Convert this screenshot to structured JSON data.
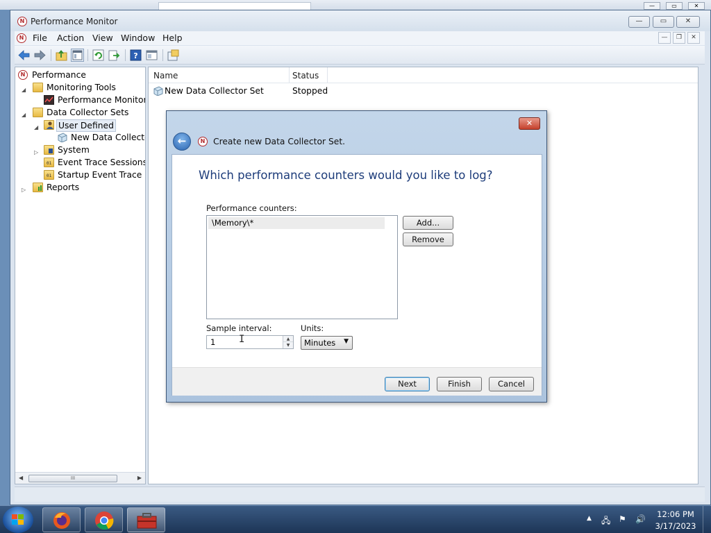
{
  "window": {
    "title": "Performance Monitor",
    "controls": {
      "minimize": "—",
      "maximize": "▭",
      "close": "✕"
    }
  },
  "menubar": {
    "items": [
      "File",
      "Action",
      "View",
      "Window",
      "Help"
    ],
    "mdi_controls": {
      "minimize": "—",
      "restore": "❐",
      "close": "✕"
    }
  },
  "toolbar": {
    "buttons": [
      "back-icon",
      "forward-icon",
      "up-folder-icon",
      "show-tree-icon",
      "refresh-icon",
      "export-icon",
      "help-icon",
      "properties-icon",
      "new-window-icon"
    ]
  },
  "tree": {
    "items": [
      {
        "label": "Performance",
        "icon": "performance-icon"
      },
      {
        "label": "Monitoring Tools",
        "icon": "folder-icon",
        "expanded": true
      },
      {
        "label": "Performance Monitor",
        "icon": "chart-icon"
      },
      {
        "label": "Data Collector Sets",
        "icon": "folder-icon",
        "expanded": true
      },
      {
        "label": "User Defined",
        "icon": "user-folder-icon",
        "expanded": true,
        "selected": true
      },
      {
        "label": "New Data Collector",
        "icon": "data-collector-icon"
      },
      {
        "label": "System",
        "icon": "system-folder-icon",
        "expanded": false
      },
      {
        "label": "Event Trace Sessions",
        "icon": "trace-folder-icon"
      },
      {
        "label": "Startup Event Trace Ses",
        "icon": "trace-folder-icon"
      },
      {
        "label": "Reports",
        "icon": "reports-folder-icon",
        "expanded": false
      }
    ],
    "scrollbar_grip": "III"
  },
  "list": {
    "columns": [
      "Name",
      "Status"
    ],
    "rows": [
      {
        "name": "New Data Collector Set",
        "status": "Stopped",
        "icon": "data-collector-icon"
      }
    ]
  },
  "dialog": {
    "title": "Create new Data Collector Set.",
    "close_label": "✕",
    "heading": "Which performance counters would you like to log?",
    "counters_label": "Performance counters:",
    "counters": [
      "\\Memory\\*"
    ],
    "add_label": "Add...",
    "remove_label": "Remove",
    "sample_interval_label": "Sample interval:",
    "sample_interval_value": "1",
    "units_label": "Units:",
    "units_value": "Minutes",
    "next_label": "Next",
    "finish_label": "Finish",
    "cancel_label": "Cancel"
  },
  "taskbar": {
    "apps": [
      "firefox-icon",
      "chrome-icon",
      "toolbox-icon"
    ],
    "time": "12:06 PM",
    "date": "3/17/2023"
  },
  "colors": {
    "dialog_heading": "#1d3c7a",
    "taskbar": "#1d3556",
    "close_red": "#c5402b"
  }
}
